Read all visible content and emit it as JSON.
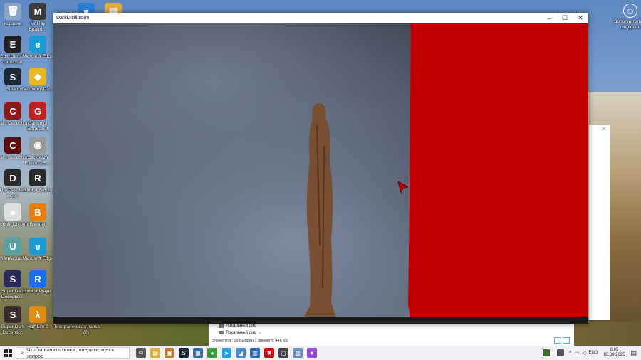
{
  "desktop_icons": [
    {
      "label": "Корзина",
      "color": "#8aa4c8",
      "glyph": "🗑"
    },
    {
      "label": "Mr Ray Beatin…",
      "color": "#3b3b3b",
      "glyph": "M"
    },
    {
      "label": "",
      "color": "#2a7fd4",
      "glyph": "■"
    },
    {
      "label": "",
      "color": "#e0b040",
      "glyph": "▤"
    },
    {
      "label": "Epic Games Launcher",
      "color": "#222",
      "glyph": "E"
    },
    {
      "label": "Microsoft Edge",
      "color": "#1b9ad6",
      "glyph": "e"
    },
    {
      "label": "Steam",
      "color": "#1b2838",
      "glyph": "S"
    },
    {
      "label": "Geometry Dash",
      "color": "#e8b820",
      "glyph": "◆"
    },
    {
      "label": "Cars Deception",
      "color": "#8a1a1a",
      "glyph": "C"
    },
    {
      "label": "Garten of BanBan 8",
      "color": "#c02020",
      "glyph": "G"
    },
    {
      "label": "Cars Deception",
      "color": "#5a1010",
      "glyph": "C"
    },
    {
      "label": "Clickteam Fusion 2.5…",
      "color": "#9a9a9a",
      "glyph": "◉"
    },
    {
      "label": "The Desolate Hope",
      "color": "#2a2a2a",
      "glyph": "D"
    },
    {
      "label": "Roblox Studio",
      "color": "#2b2b2b",
      "glyph": "R"
    },
    {
      "label": "Google Chrome",
      "color": "#e0e0e0",
      "glyph": "●"
    },
    {
      "label": "Blender",
      "color": "#e87d0d",
      "glyph": "B"
    },
    {
      "label": "Unplagued",
      "color": "#5aa0a0",
      "glyph": "U"
    },
    {
      "label": "Microsoft Edge",
      "color": "#1b9ad6",
      "glyph": "e"
    },
    {
      "label": "Super Dark Deceptio…",
      "color": "#2a2a5a",
      "glyph": "S"
    },
    {
      "label": "Roblox Player",
      "color": "#1a6ef0",
      "glyph": "R"
    },
    {
      "label": "Super Dark Deception",
      "color": "#3a2a2a",
      "glyph": "S"
    },
    {
      "label": "Half-Life 2",
      "color": "#e08a10",
      "glyph": "λ"
    },
    {
      "label": "Telegram",
      "color": "#2aa0d8",
      "glyph": ""
    },
    {
      "label": "Новая папка (2)",
      "color": "#e8c050",
      "glyph": ""
    }
  ],
  "user_icon": {
    "label": "Дополнитель… сведения",
    "glyph": "☺"
  },
  "app_window": {
    "title": "DarkDisillusion",
    "controls": {
      "minimize": "–",
      "maximize": "☐",
      "close": "✕"
    },
    "scene_color": "#c00000"
  },
  "explorer": {
    "close": "✕",
    "rows": [
      "Локальный дис",
      "Локальный дис"
    ],
    "status": "Элементов: 10     Выбран 1 элемент: 446 КБ"
  },
  "taskbar": {
    "search_placeholder": "Чтобы начать поиск, введите здесь запрос",
    "pinned": [
      {
        "name": "task-view",
        "color": "#555",
        "glyph": "⧉"
      },
      {
        "name": "file-explorer",
        "color": "#e0b040",
        "glyph": "▤"
      },
      {
        "name": "app-2",
        "color": "#c07a30",
        "glyph": "▣"
      },
      {
        "name": "steam",
        "color": "#1b2838",
        "glyph": "S"
      },
      {
        "name": "app-4",
        "color": "#3a6ea8",
        "glyph": "▦"
      },
      {
        "name": "chrome",
        "color": "#3c9b3c",
        "glyph": "●"
      },
      {
        "name": "telegram",
        "color": "#2aa0d8",
        "glyph": "➤"
      },
      {
        "name": "app-7",
        "color": "#4a8ad0",
        "glyph": "◢"
      },
      {
        "name": "app-8",
        "color": "#2a6ab8",
        "glyph": "▥"
      },
      {
        "name": "app-9",
        "color": "#c01010",
        "glyph": "✖"
      },
      {
        "name": "app-10",
        "color": "#444",
        "glyph": "▢"
      },
      {
        "name": "app-11",
        "color": "#6a8ab8",
        "glyph": "▨"
      },
      {
        "name": "app-12",
        "color": "#9a4ad8",
        "glyph": "♥"
      }
    ],
    "tray": {
      "lang": "ENG",
      "time": "8:05",
      "date": "05.08.2025"
    }
  }
}
